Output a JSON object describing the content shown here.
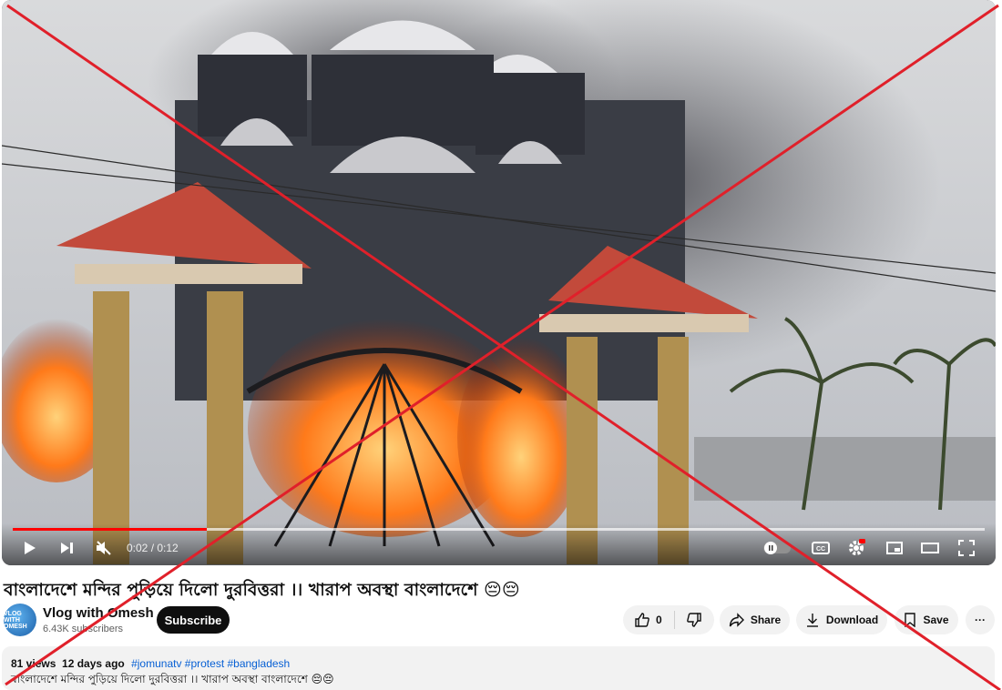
{
  "player": {
    "time_display": "0:02 / 0:12",
    "progress_fraction": 0.2
  },
  "video": {
    "title": "বাংলাদেশে মন্দির পুড়িয়ে দিলো দুরবিত্তরা ।। খারাপ অবস্থা বাংলাদেশে 😔😔"
  },
  "channel": {
    "name": "Vlog with Omesh",
    "subscribers": "6.43K subscribers",
    "avatar_text": "VLOG WITH OMESH",
    "subscribe_label": "Subscribe"
  },
  "actions": {
    "like_count": "0",
    "share_label": "Share",
    "download_label": "Download",
    "save_label": "Save",
    "more_label": "···"
  },
  "description": {
    "views": "81 views",
    "age": "12 days ago",
    "tags": "#jomunatv #protest #bangladesh",
    "text": "বাংলাদেশে মন্দির পুড়িয়ে দিলো দুরবিত্তরা ।। খারাপ অবস্থা বাংলাদেশে 😔😔"
  },
  "colors": {
    "progress_played": "#ff0000",
    "cross_overlay": "#e0202a",
    "subscribe_bg": "#0f0f0f",
    "hashtag": "#065fd4"
  }
}
